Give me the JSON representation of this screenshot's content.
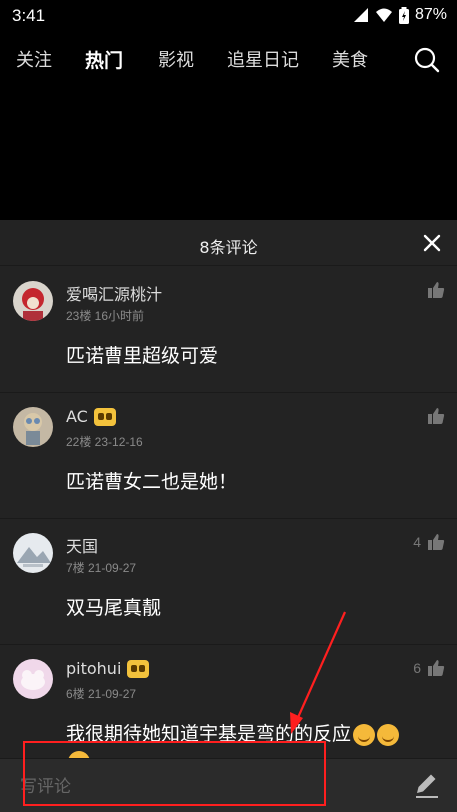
{
  "status": {
    "time": "3:41",
    "battery": "87%"
  },
  "tabs": [
    {
      "label": "关注",
      "active": false
    },
    {
      "label": "热门",
      "active": true
    },
    {
      "label": "影视",
      "active": false
    },
    {
      "label": "追星日记",
      "active": false
    },
    {
      "label": "美食",
      "active": false
    }
  ],
  "sheet": {
    "title": "8条评论"
  },
  "comments": [
    {
      "name": "爱喝汇源桃汁",
      "meta": "23楼 16小时前",
      "text": "匹诺曹里超级可爱",
      "likes": "",
      "badge": false
    },
    {
      "name": "AC",
      "meta": "22楼 23-12-16",
      "text": "匹诺曹女二也是她！",
      "likes": "",
      "badge": true
    },
    {
      "name": "天国",
      "meta": "7楼 21-09-27",
      "text": "双马尾真靓",
      "likes": "4",
      "badge": false
    },
    {
      "name": "pitohui",
      "meta": "6楼 21-09-27",
      "text": "我很期待她知道宇基是弯的的反应",
      "likes": "6",
      "badge": true
    }
  ],
  "composer": {
    "placeholder": "写评论"
  },
  "colors": {
    "highlight": "#ff1f1f",
    "sheet_bg": "#232323"
  }
}
